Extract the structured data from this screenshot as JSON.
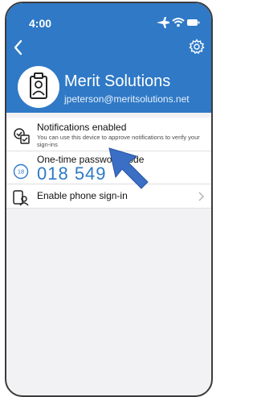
{
  "status_bar": {
    "time": "4:00",
    "icons": [
      "airplane-icon",
      "wifi-icon",
      "battery-icon"
    ]
  },
  "nav": {
    "back_icon": "chevron-left-icon",
    "settings_icon": "gear-icon"
  },
  "account": {
    "name": "Merit Solutions",
    "email": "jpeterson@meritsolutions.net",
    "badge_icon": "id-badge-icon"
  },
  "items": {
    "notifications": {
      "title": "Notifications enabled",
      "description": "You can use this device to approve notifications to verify your sign-ins",
      "icon": "check-notification-icon"
    },
    "otp": {
      "label": "One-time password code",
      "code": "018 549",
      "timer": "18",
      "icon": "countdown-timer-icon"
    },
    "phone_signin": {
      "label": "Enable phone sign-in",
      "icon": "phone-signin-icon"
    }
  },
  "colors": {
    "header": "#2f79c6",
    "accent": "#2f79c6",
    "background": "#f2f2f4"
  }
}
